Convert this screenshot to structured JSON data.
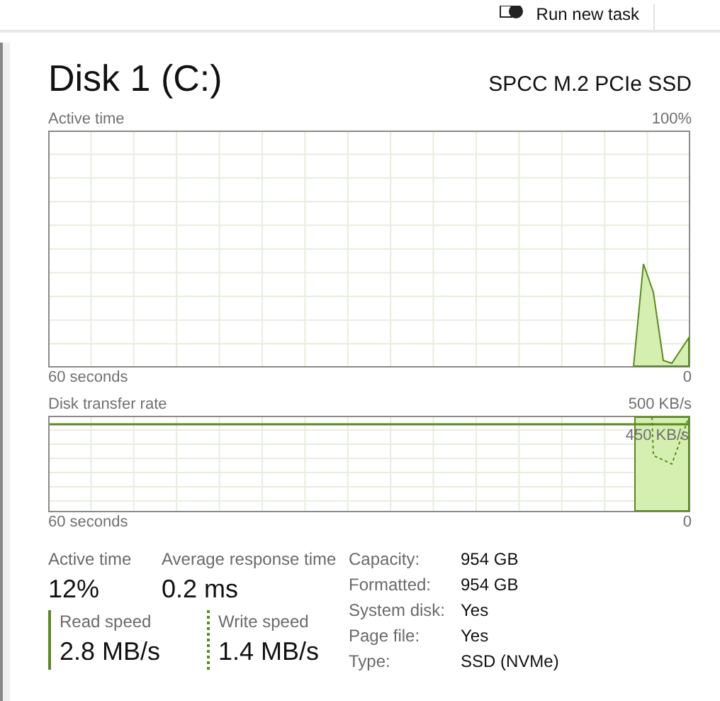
{
  "toolbar": {
    "run_new_task": "Run new task"
  },
  "disk": {
    "title": "Disk 1 (C:)",
    "model": "SPCC M.2 PCIe SSD"
  },
  "active_time_graph": {
    "label": "Active time",
    "max": "100%",
    "time_span": "60 seconds",
    "min": "0"
  },
  "transfer_graph": {
    "label": "Disk transfer rate",
    "max": "500 KB/s",
    "marker": "450 KB/s",
    "time_span": "60 seconds",
    "min": "0"
  },
  "stats": [
    {
      "label": "Active time",
      "value": "12%"
    },
    {
      "label": "Average response time",
      "value": "0.2 ms"
    }
  ],
  "speeds": [
    {
      "label": "Read speed",
      "value": "2.8 MB/s",
      "kind": "solid"
    },
    {
      "label": "Write speed",
      "value": "1.4 MB/s",
      "kind": "dotted"
    }
  ],
  "properties": [
    {
      "label": "Capacity:",
      "value": "954 GB"
    },
    {
      "label": "Formatted:",
      "value": "954 GB"
    },
    {
      "label": "System disk:",
      "value": "Yes"
    },
    {
      "label": "Page file:",
      "value": "Yes"
    },
    {
      "label": "Type:",
      "value": "SSD (NVMe)"
    }
  ]
}
